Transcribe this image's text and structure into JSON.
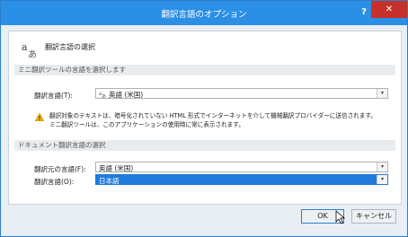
{
  "window": {
    "title": "翻訳言語のオプション",
    "help_label": "?",
    "close_label": "✕"
  },
  "header": {
    "title": "翻訳言語の選択",
    "icon": "translate-icon"
  },
  "mini_section": {
    "title": "ミニ翻訳ツールの言語を選択します",
    "translate_label": "翻訳言語(T):",
    "translate_value": "英語 (米国)",
    "translate_value_icon": "translate-small-icon",
    "warning_line1": "翻訳対象のテキストは、暗号化されていない HTML 形式でインターネットを介して機械翻訳プロバイダーに送信されます。",
    "warning_line2": "ミニ翻訳ツールは、このアプリケーションの使用時に常に表示されます。"
  },
  "doc_section": {
    "title": "ドキュメント翻訳言語の選択",
    "source_label": "翻訳元の言語(F):",
    "source_value": "英語 (米国)",
    "target_label": "翻訳言語(O):",
    "target_value": "日本語"
  },
  "footer": {
    "ok_label": "OK",
    "cancel_label": "キャンセル"
  },
  "colors": {
    "titlebar": "#2b8fe6",
    "close": "#c7312b",
    "selection": "#1f7bdc"
  }
}
